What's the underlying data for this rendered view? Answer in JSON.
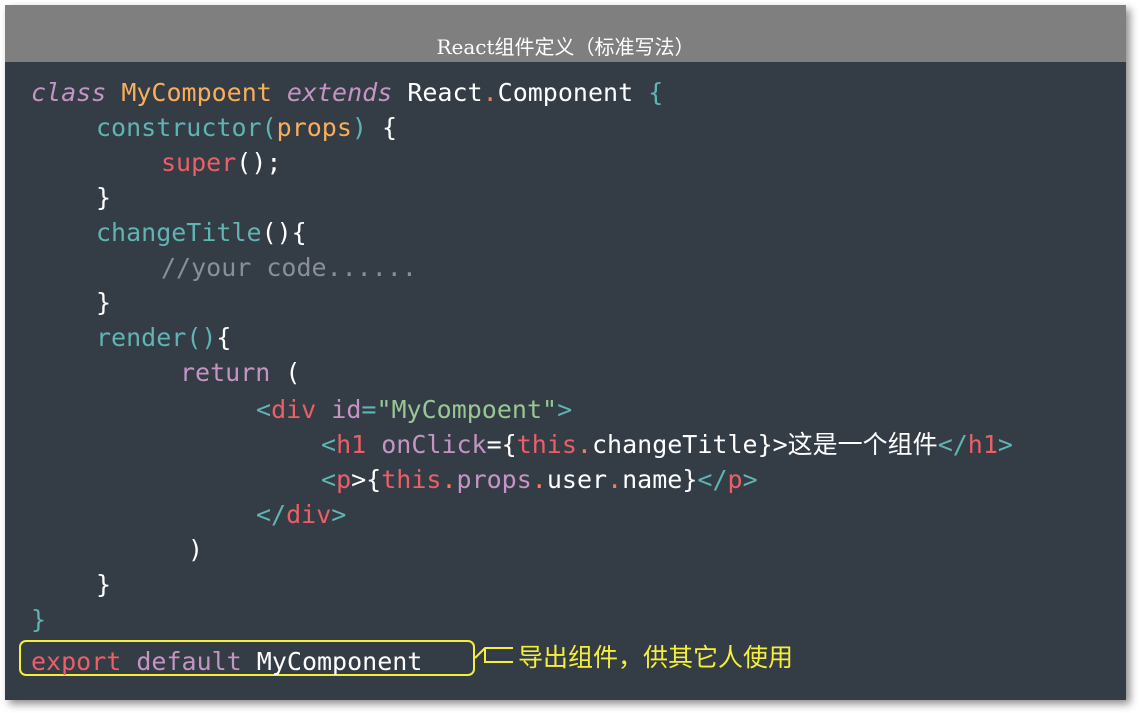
{
  "title": "React组件定义（标准写法）",
  "code": {
    "l1": {
      "a": "class",
      "b": "MyCompoent",
      "c": "extends",
      "d": "React",
      "e": ".",
      "f": "Component",
      "g": "{"
    },
    "l2": {
      "a": "constructor",
      "b": "(",
      "c": "props",
      "d": ")",
      "e": "{"
    },
    "l3": {
      "a": "super",
      "b": "();"
    },
    "l4": {
      "a": "}"
    },
    "l5": {
      "a": "changeTitle",
      "b": "(){"
    },
    "l6": {
      "a": "//your code......"
    },
    "l7": {
      "a": "}"
    },
    "l8": {
      "a": "render",
      "b": "()",
      "c": "{"
    },
    "l9": {
      "a": "return",
      "b": "("
    },
    "l10": {
      "a": "<",
      "b": "div",
      "c": "id",
      "d": "=",
      "e": "\"MyCompoent\"",
      "f": ">"
    },
    "l11": {
      "a": "<",
      "b": "h1",
      "c": "onClick",
      "d": "={",
      "e": "this",
      "f": ".",
      "g": "changeTitle",
      "h": "}>",
      "i": "这是一个组件",
      "j": "</",
      "k": "h1",
      "l": ">"
    },
    "l12": {
      "a": "<",
      "b": "p",
      "c": ">{",
      "d": "this",
      "e": ".",
      "f": "props",
      "g": ".",
      "h": "user",
      "i": ".",
      "j": "name",
      "k": "}",
      "l": "</",
      "m": "p",
      "n": ">"
    },
    "l13": {
      "a": "</",
      "b": "div",
      "c": ">"
    },
    "l14": {
      "a": ")"
    },
    "l15": {
      "a": "}"
    },
    "l16": {
      "a": "}"
    },
    "l17": {
      "a": "export",
      "b": "default",
      "c": "MyComponent"
    }
  },
  "annotation": "导出组件，供其它人使用",
  "colors": {
    "background": "#343c46",
    "title_bar": "#7f7f7f",
    "highlight": "#f5ef3a"
  }
}
